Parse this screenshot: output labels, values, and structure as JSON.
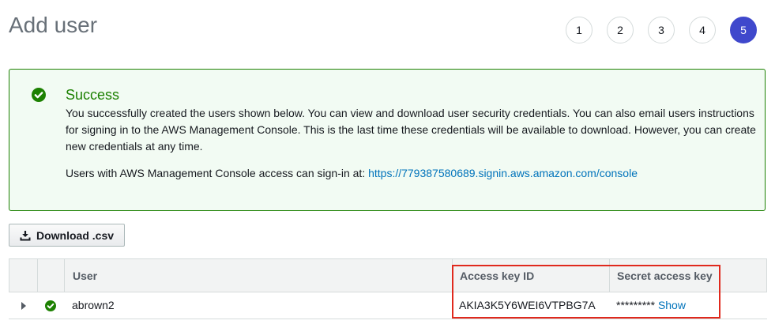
{
  "page": {
    "title": "Add user"
  },
  "steps": [
    "1",
    "2",
    "3",
    "4",
    "5"
  ],
  "active_step": "5",
  "alert": {
    "heading": "Success",
    "message": "You successfully created the users shown below. You can view and download user security credentials. You can also email users instructions for signing in to the AWS Management Console. This is the last time these credentials will be available to download. However, you can create new credentials at any time.",
    "signin_prefix": "Users with AWS Management Console access can sign-in at: ",
    "signin_url": "https://779387580689.signin.aws.amazon.com/console",
    "color": "#1d8102"
  },
  "toolbar": {
    "download_label": "Download .csv",
    "download_icon": "download-icon"
  },
  "table": {
    "headers": {
      "user": "User",
      "access_key_id": "Access key ID",
      "secret_access_key": "Secret access key"
    },
    "rows": [
      {
        "user": "abrown2",
        "access_key_id": "AKIA3K5Y6WEI6VTPBG7A",
        "secret_masked": "*********",
        "show_label": "Show"
      }
    ]
  },
  "colors": {
    "accent": "#3f48cc",
    "link": "#0073bb",
    "highlight": "#e0291d"
  }
}
